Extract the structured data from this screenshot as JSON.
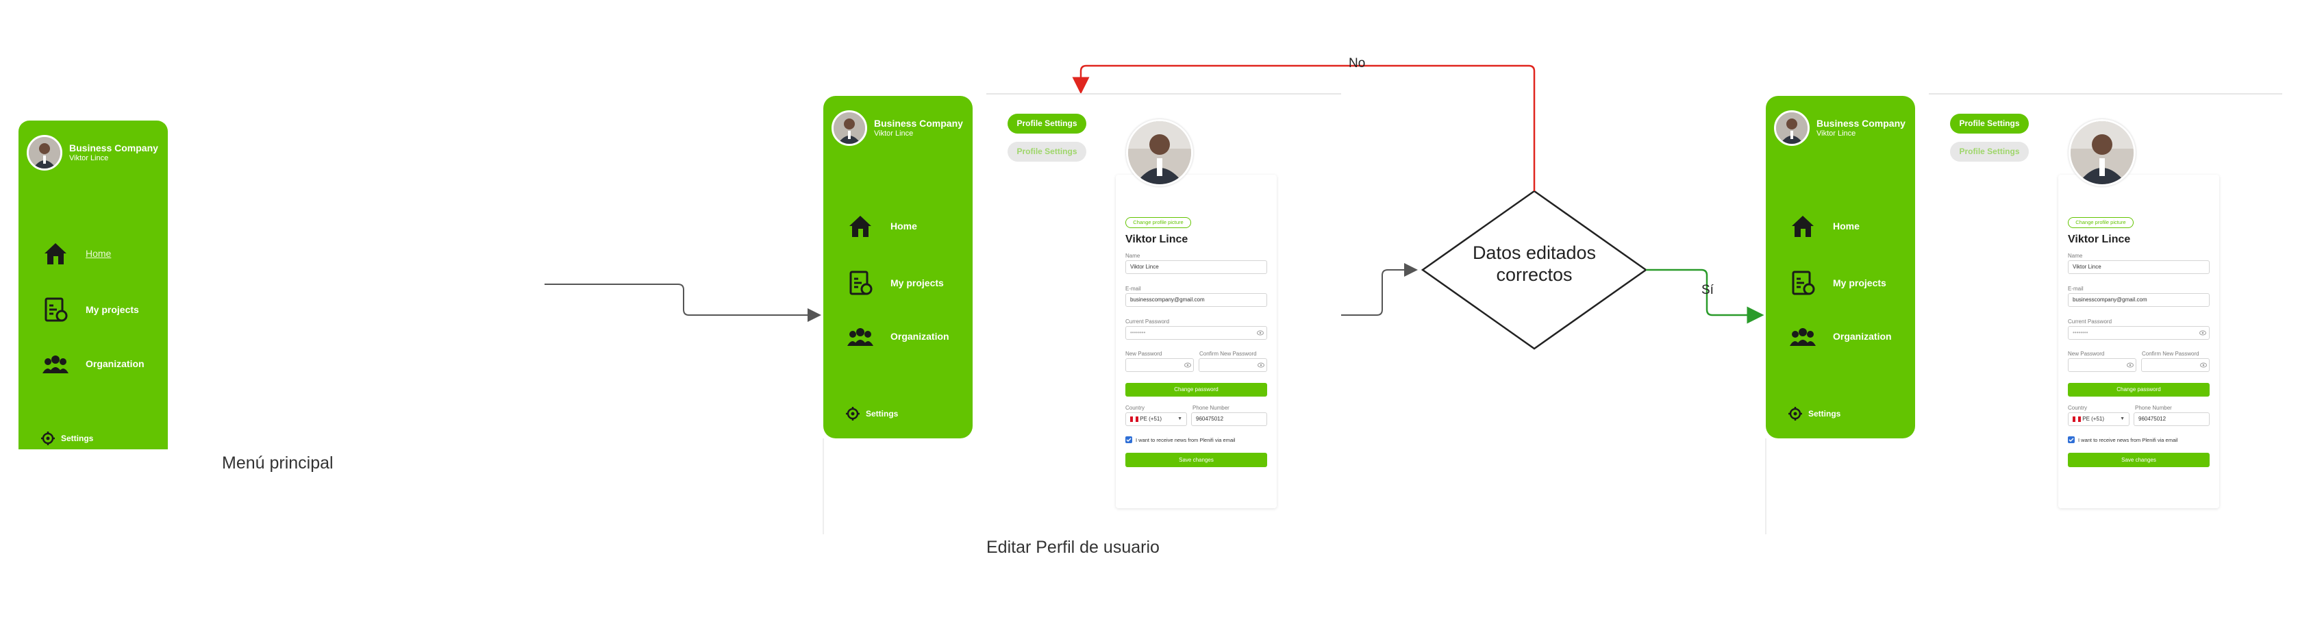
{
  "screens": {
    "menu": {
      "company": "Business Company",
      "user": "Viktor Lince",
      "nav": [
        "Home",
        "My projects",
        "Organization"
      ],
      "settings": "Settings",
      "caption": "Menú principal"
    },
    "edit": {
      "company": "Business Company",
      "user": "Viktor Lince",
      "nav": [
        "Home",
        "My projects",
        "Organization"
      ],
      "settings": "Settings",
      "tabs": [
        "Profile Settings",
        "Profile Settings"
      ],
      "change_picture": "Change profile picture",
      "profile_name": "Viktor Lince",
      "name_label": "Name",
      "name_value": "Viktor Lince",
      "email_label": "E-mail",
      "email_value": "businesscompany@gmail.com",
      "current_password_label": "Current Password",
      "password_mask": "••••••••",
      "new_password_label": "New Password",
      "confirm_password_label": "Confirm New Password",
      "change_password_button": "Change password",
      "country_label": "Country",
      "country_value": "PE (+51)",
      "phone_label": "Phone Number",
      "phone_value": "960475012",
      "newsletter_label": "I want to receive news from Plenifi via email",
      "save_button": "Save changes",
      "caption": "Editar Perfil de usuario"
    },
    "result": {
      "company": "Business Company",
      "user": "Viktor Lince",
      "nav": [
        "Home",
        "My projects",
        "Organization"
      ],
      "settings": "Settings",
      "tabs": [
        "Profile Settings",
        "Profile Settings"
      ],
      "change_picture": "Change profile picture",
      "profile_name": "Viktor Lince",
      "name_label": "Name",
      "name_value": "Viktor Lince",
      "email_label": "E-mail",
      "email_value": "businesscompany@gmail.com",
      "current_password_label": "Current Password",
      "password_mask": "••••••••",
      "new_password_label": "New Password",
      "confirm_password_label": "Confirm New Password",
      "change_password_button": "Change password",
      "country_label": "Country",
      "country_value": "PE (+51)",
      "phone_label": "Phone Number",
      "phone_value": "960475012",
      "newsletter_label": "I want to receive news from Plenifi via email",
      "save_button": "Save changes"
    }
  },
  "decision": {
    "text_line1": "Datos editados",
    "text_line2": "correctos",
    "yes_label": "Sí",
    "no_label": "No"
  },
  "colors": {
    "brand_green": "#63c401",
    "no_arrow": "#e0261f",
    "yes_arrow": "#2a9b2a",
    "flow_arrow": "#555555"
  },
  "icons": [
    "house-icon",
    "projects-icon",
    "organization-icon",
    "gear-icon",
    "flag-peru-icon",
    "checkbox-icon",
    "eye-icon"
  ]
}
